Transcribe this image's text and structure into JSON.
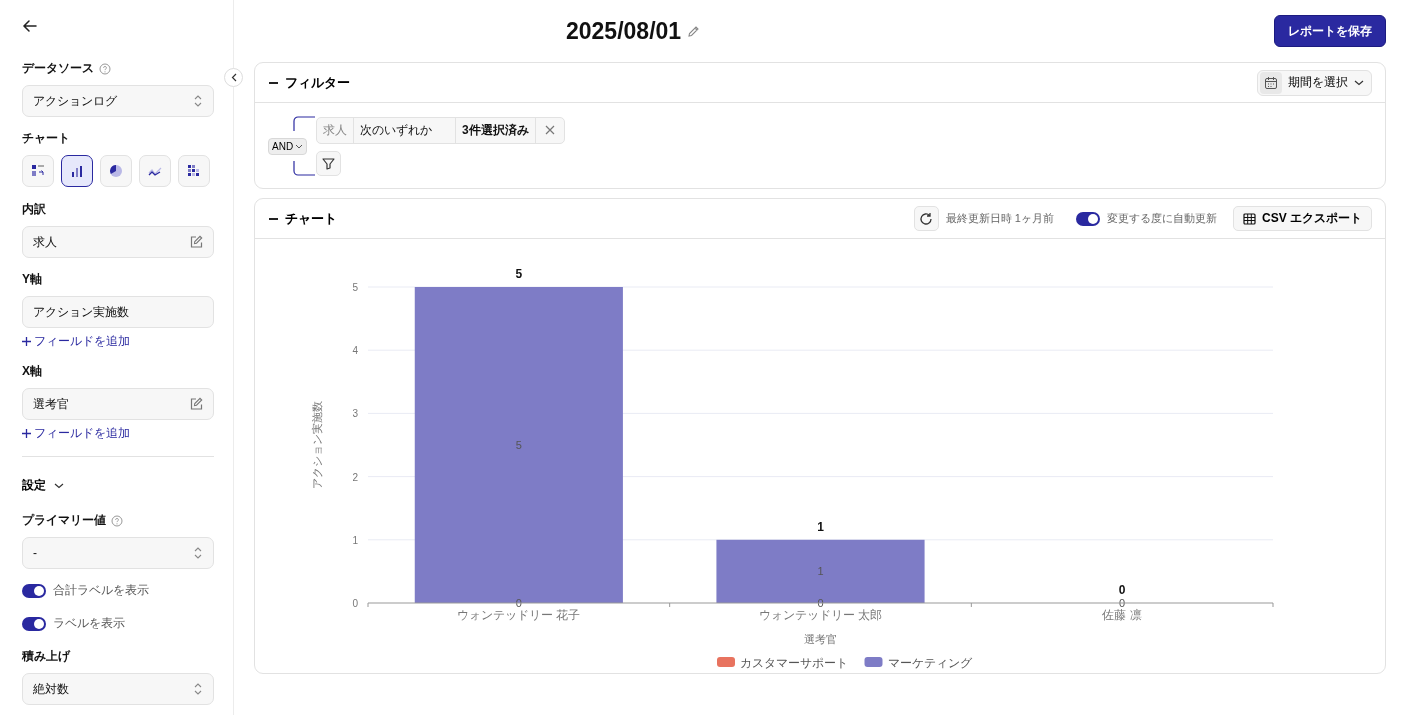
{
  "header": {
    "title": "2025/08/01",
    "save_button": "レポートを保存"
  },
  "sidebar": {
    "sections": [
      {
        "kind": "select",
        "label": "データソース",
        "help": true,
        "value": "アクションログ"
      },
      {
        "kind": "chart_types",
        "label": "チャート",
        "items": [
          {
            "kind": "table",
            "selected": false
          },
          {
            "kind": "bar",
            "selected": true
          },
          {
            "kind": "pie",
            "selected": false
          },
          {
            "kind": "line",
            "selected": false
          },
          {
            "kind": "heatmap",
            "selected": false
          }
        ]
      },
      {
        "kind": "edit",
        "label": "内訳",
        "value": "求人"
      },
      {
        "kind": "text",
        "label": "Y軸",
        "value": "アクション実施数",
        "add_link": "フィールドを追加"
      },
      {
        "kind": "edit",
        "label": "X軸",
        "value": "選考官",
        "add_link": "フィールドを追加"
      },
      {
        "kind": "divider"
      },
      {
        "kind": "collapsible",
        "label": "設定",
        "expanded": true
      },
      {
        "kind": "select",
        "label": "プライマリー値",
        "help": true,
        "value": "-"
      },
      {
        "kind": "toggle",
        "label": "合計ラベルを表示",
        "on": true
      },
      {
        "kind": "toggle",
        "label": "ラベルを表示",
        "on": true
      },
      {
        "kind": "select",
        "label": "積み上げ",
        "value": "絶対数"
      }
    ]
  },
  "filter_panel": {
    "title": "フィルター",
    "period_button": "期間を選択",
    "logic": "AND",
    "conditions": [
      {
        "field": "求人",
        "operator": "次のいずれか",
        "value": "3件選択済み"
      }
    ]
  },
  "chart_panel": {
    "title": "チャート",
    "last_updated": "最終更新日時 1ヶ月前",
    "auto_update": {
      "label": "変更する度に自動更新",
      "on": true
    },
    "export_button": "CSV エクスポート",
    "chart_data": {
      "type": "bar",
      "xlabel": "選考官",
      "ylabel": "アクション実施数",
      "categories": [
        "ウォンテッドリー 花子",
        "ウォンテッドリー 太郎",
        "佐藤 凛"
      ],
      "series": [
        {
          "name": "カスタマーサポート",
          "color": "#e8735f",
          "values": [
            0,
            0,
            0
          ]
        },
        {
          "name": "マーケティング",
          "color": "#7e7cc6",
          "values": [
            5,
            1,
            0
          ]
        }
      ],
      "stacked": true,
      "value_labels": [
        [
          "0",
          "0",
          "0"
        ],
        [
          "5",
          "1",
          null
        ]
      ],
      "annotations": [
        {
          "x": "ウォンテッドリー 花子",
          "y": 5,
          "text": "5"
        },
        {
          "x": "ウォンテッドリー 太郎",
          "y": 1,
          "text": "1"
        },
        {
          "x": "佐藤 凛",
          "y": 0,
          "text": "0"
        }
      ],
      "grid": true,
      "ylim": [
        0,
        5
      ],
      "yticks": [
        0,
        1,
        2,
        3,
        4,
        5
      ]
    }
  }
}
